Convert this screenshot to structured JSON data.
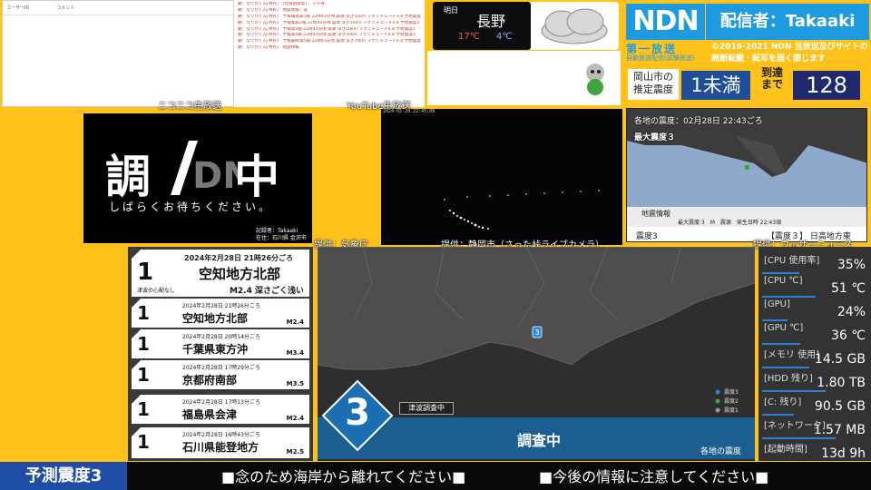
{
  "comments": {
    "col_user": "ユーザーID",
    "col_comment": "コメント",
    "source_label": "ニコニコ生放送"
  },
  "chat": {
    "lines": [
      "朝：なりかくん[共有]　[北海道震度] ：小千谷",
      "朝：なりかくん[共有]　地震情報：第",
      "朝：なりかくん[共有]　予報報発表1報 22時43分頃 震源 深さ50km マグニチュード3.9 予想震度2",
      "朝：なりかくん[共有]　予報発表2報 22時43分頃 震源 深さ50km マグニチュード4.8 予想震度3",
      "朝：なりかくん[共有]　予報第3報 22時43分頃 震源 深さ50km マグニチュード4.8 予想震度3",
      "朝：なりかくん[共有]　予報第4報 22時43分頃 震源 深さ50km マグニチュード4.8 予想震度3",
      "朝：なりかくん[共有]　予報最終第5報 22時43分頃 震源 深さ70km マグニチュード4.4 予想震度3",
      "朝：なりかくん[共有]　地震情報"
    ],
    "source_label": "YouTube生放送"
  },
  "weather": {
    "day": "明日",
    "city": "長野",
    "high": "17℃",
    "low": "4℃"
  },
  "header": {
    "logo": "NDN",
    "streamer": "配信者：Takaaki",
    "channel": "第一放送",
    "channel_sub": "自動放送配信(試験放送)",
    "copyright_line1": "©2019-2021 NDN 当放送及びサイトの",
    "copyright_line2": "無断転載・転写を固く禁じます",
    "region_label_1": "岡山市の",
    "region_label_2": "推定震度",
    "intensity": "1未満",
    "reach_label_1": "到達",
    "reach_label_2": "まで",
    "countdown": "128"
  },
  "investigating": {
    "title_left": "調",
    "title_right": "中",
    "subtitle": "しばらくお待ちください。",
    "credit_line1": "記録者：Takaaki",
    "credit_line2": "在住：石川県 金沢市",
    "source_label": "提供：気象庁"
  },
  "camera": {
    "timestamp": "2024-02-28 22:45:09",
    "source_label": "提供：静岡市（さった峠ライブカメラ）"
  },
  "map_tr": {
    "title": "各地の震度：02月28日 22:43ごろ",
    "max": "最大震度３",
    "info_title": "地震情報",
    "info_row": "最大震度 3　M　震源　発生日時 22:43頃",
    "footer_left": "震度3",
    "footer_right": "【震度３】 日高地方東",
    "source_label": "提供：ウェザーニュース"
  },
  "eqlist": [
    {
      "int": "1",
      "date": "2024年2月28日 21時26分ごろ",
      "place": "空知地方北部",
      "tsunami": "津波の心配なし",
      "mag": "M2.4 深さごく浅い"
    },
    {
      "int": "1",
      "date": "2024年2月28日 21時26分ごろ",
      "place": "空知地方北部",
      "mag": "M2.4"
    },
    {
      "int": "1",
      "date": "2024年2月28日 20時14分ごろ",
      "place": "千葉県東方沖",
      "mag": "M3.4"
    },
    {
      "int": "1",
      "date": "2024年2月28日 17時29分ごろ",
      "place": "京都府南部",
      "mag": "M3.5"
    },
    {
      "int": "1",
      "date": "2024年2月28日 17時13分ごろ",
      "place": "福島県会津",
      "mag": "M2.4"
    },
    {
      "int": "1",
      "date": "2024年2月28日 16時43分ごろ",
      "place": "石川県能登地方",
      "mag": "M2.5"
    }
  ],
  "mainmap": {
    "big_intensity": "3",
    "tsunami_label": "津波調査中",
    "status": "調査中",
    "footer": "各地の震度",
    "marker": "3",
    "legend": [
      "震度3",
      "震度2",
      "震度1"
    ]
  },
  "stats": [
    {
      "label": "[CPU 使用率]",
      "value": "35%",
      "fill": 0.35
    },
    {
      "label": "[CPU ℃]",
      "value": "51 ℃",
      "fill": 0.51
    },
    {
      "label": "[GPU]",
      "value": "24%",
      "fill": 0.24
    },
    {
      "label": "[GPU ℃]",
      "value": "36 ℃",
      "fill": 0.36
    },
    {
      "label": "[メモリ 使用]",
      "value": "14.5 GB",
      "fill": 0.45
    },
    {
      "label": "[HDD 残り]",
      "value": "1.80 TB",
      "fill": 0.6
    },
    {
      "label": "[C: 残り]",
      "value": "90.5 GB",
      "fill": 0.3
    },
    {
      "label": "[ネットワーク]",
      "value": "1.57 MB",
      "fill": 0.7
    },
    {
      "label": "[起動時間]",
      "value": "13d 9h",
      "fill": 0
    }
  ],
  "bottom": {
    "predict": "予測震度3",
    "msg1": "■念のため海岸から離れてください■",
    "msg2": "■今後の情報に注意してください■"
  },
  "colors": {
    "accent": "#1e9be0",
    "background": "#ffc21a",
    "intensity3": "#1b6fb0"
  }
}
